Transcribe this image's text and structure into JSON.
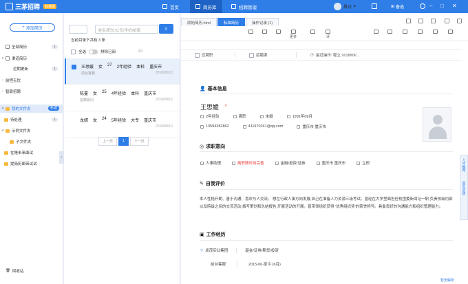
{
  "app": {
    "name": "三茅招聘",
    "version": "标准版"
  },
  "nav": {
    "home": "首页",
    "resume_lib": "简历库",
    "recruit_mgmt": "招聘管理"
  },
  "user": {
    "name": "晨讯",
    "backup": "备选"
  },
  "sidebar": {
    "add_label": "添加简历",
    "items": [
      {
        "label": "全部简历",
        "count": "1"
      },
      {
        "label": "渠道简历",
        "count": ""
      },
      {
        "label": "近期更新",
        "count": "1"
      },
      {
        "label": "前程无忧",
        "count": ""
      },
      {
        "label": "智联招聘",
        "count": ""
      }
    ],
    "my_folders": "我的文件夹",
    "new_btn": "新建",
    "folders": [
      {
        "label": "待处理",
        "count": "1"
      },
      {
        "label": "示例文件夹",
        "count": ""
      },
      {
        "label": "子文件夹",
        "count": ""
      },
      {
        "label": "在睡未来面试",
        "count": ""
      },
      {
        "label": "提简历面带试试",
        "count": ""
      }
    ],
    "recycle": "回收站"
  },
  "list": {
    "search_placeholder": "姓名/职位/公司/手机/邮箱",
    "current_dir": "当前目录下共有",
    "current_count": "3",
    "current_suffix": "条",
    "select_all": "全选",
    "exclude": "排除已阅",
    "sort": "JO",
    "cards": [
      {
        "name": "王思媛",
        "gender": "女",
        "age": "27",
        "exp": "2年经验",
        "edu": "本科",
        "city": "重庆市",
        "tag": "前台客服",
        "date": "2018/09/12"
      },
      {
        "name": "陈蔓",
        "gender": "女",
        "age": "25",
        "exp": "4年经验",
        "edu": "本科",
        "city": "重庆市",
        "tag": "招聘顾问",
        "date": "2018/09/12"
      },
      {
        "name": "龙婧",
        "gender": "女",
        "age": "24",
        "exp": "5年经验",
        "edu": "大专",
        "city": "重庆市",
        "tag": "",
        "date": "2018/09/12"
      }
    ],
    "pager": {
      "prev": "上一页",
      "page": "1",
      "next": "下一页"
    }
  },
  "detail": {
    "tabs": [
      "原始简历.html",
      "标准简历",
      "操作记录 (1)"
    ],
    "tools": [
      "",
      "",
      "",
      "更多",
      "",
      "评"
    ],
    "info": {
      "job_label": "应聘职",
      "channel_label": "招聘渠",
      "last_op": "最近操作: 程立  2018/09/..."
    },
    "basic_title": "基本信息",
    "name": "王思媛",
    "fields": {
      "exp": "2年经验",
      "status": "离职",
      "marital": "未婚",
      "birth": "1991年09月",
      "phone": "13594282862",
      "email": "411970241@qq.com",
      "city": "重庆市 重庆市"
    },
    "intent_title": "求职意向",
    "intent": {
      "job": "人事助理",
      "status": "离职随时待完善",
      "industry": "金融/投资/证券",
      "location": "重庆市 重庆市",
      "salary": "立即"
    },
    "eval_title": "自我评价",
    "eval_text": "本人性格开朗、善于沟通、喜欢与人交流。 想在行政人事方向发展,自己在准备人力资源三级考试。曾经在大学里面担任校团委新闻记一职,负责校级内部以及院级之间的交流活动,撰写策划和总结报告,开展活动的开展。曾带领组织获得 '优秀组织奖'的荣誉称号。具备良好的沟通能力和组织管理能力。",
    "work_title": "工作经历",
    "work": {
      "company": "卓茂实业集团",
      "industry": "基金/证券/期货/投资",
      "position": "前台客服",
      "period": "2015-06-至今 (6月)"
    },
    "side_tabs": [
      "人才推荐",
      "意见反馈"
    ],
    "bottom_tip": "暂无解析"
  }
}
